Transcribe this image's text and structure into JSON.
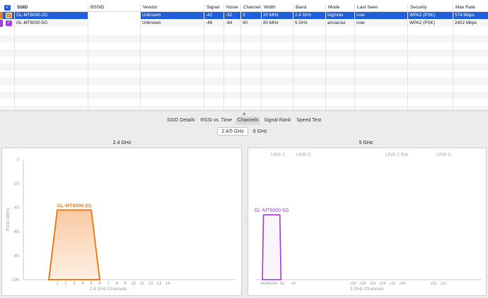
{
  "table": {
    "columns": {
      "ssid": "SSID",
      "bssid": "BSSID",
      "vendor": "Vendor",
      "signal": "Signal",
      "noise": "Noise",
      "channel": "Channel",
      "width": "Width",
      "band": "Band",
      "mode": "Mode",
      "last_seen": "Last Seen",
      "security": "Security",
      "max_rate": "Max Rate"
    },
    "rows": [
      {
        "ssid": "GL-MT6000-2G",
        "bssid": "",
        "vendor": "Unknown",
        "signal": "-42",
        "noise": "-92",
        "channel": "3",
        "width": "20 MHz",
        "band": "2.4 GHz",
        "mode": "b/g/n/ax",
        "last_seen": "now",
        "security": "WPA2 (PSK)",
        "max_rate": "574 Mbps",
        "color": "#f07d1a",
        "selected": true
      },
      {
        "ssid": "GL-MT6000-5G",
        "bssid": "",
        "vendor": "Unknown",
        "signal": "-46",
        "noise": "-94",
        "channel": "40",
        "width": "80 MHz",
        "band": "5 GHz",
        "mode": "a/n/ac/ax",
        "last_seen": "now",
        "security": "WPA2 (PSK)",
        "max_rate": "2402 Mbps",
        "color": "#a33fe0",
        "selected": false
      }
    ]
  },
  "tabs": [
    "SSID Details",
    "RSSI vs. Time",
    "Channels",
    "Signal Rank",
    "Speed Test"
  ],
  "active_tab": "Channels",
  "subtabs": [
    "2.4/5 GHz",
    "6 GHz"
  ],
  "active_subtab": "2.4/5 GHz",
  "chart_data": [
    {
      "type": "area",
      "title": "2.4 GHz",
      "xlabel": "2.4 GHz Channels",
      "ylabel": "RSSI (dBm)",
      "ylim": [
        -100,
        0
      ],
      "yticks": [
        0,
        -20,
        -40,
        -60,
        -80,
        -100
      ],
      "xticks": [
        1,
        2,
        3,
        4,
        5,
        6,
        7,
        8,
        9,
        10,
        11,
        12,
        13,
        14
      ],
      "grid": false,
      "series": [
        {
          "name": "GL-MT6000-2G",
          "color": "#f07d1a",
          "channel": 3,
          "span": [
            1,
            5
          ],
          "rssi": -42
        }
      ]
    },
    {
      "type": "area",
      "title": "5 GHz",
      "xlabel": "5 GHz Channels",
      "band_labels": [
        "UNII-1",
        "UNII-2",
        "UNII-2 Ext",
        "UNII-3"
      ],
      "xticks": [
        34,
        38,
        42,
        46,
        52,
        60,
        100,
        108,
        116,
        124,
        132,
        140,
        153,
        161
      ],
      "ylim": [
        -100,
        0
      ],
      "grid": false,
      "series": [
        {
          "name": "GL-MT6000-5G",
          "color": "#a33fe0",
          "channel": 40,
          "span": [
            36,
            48
          ],
          "rssi": -46
        }
      ]
    }
  ]
}
